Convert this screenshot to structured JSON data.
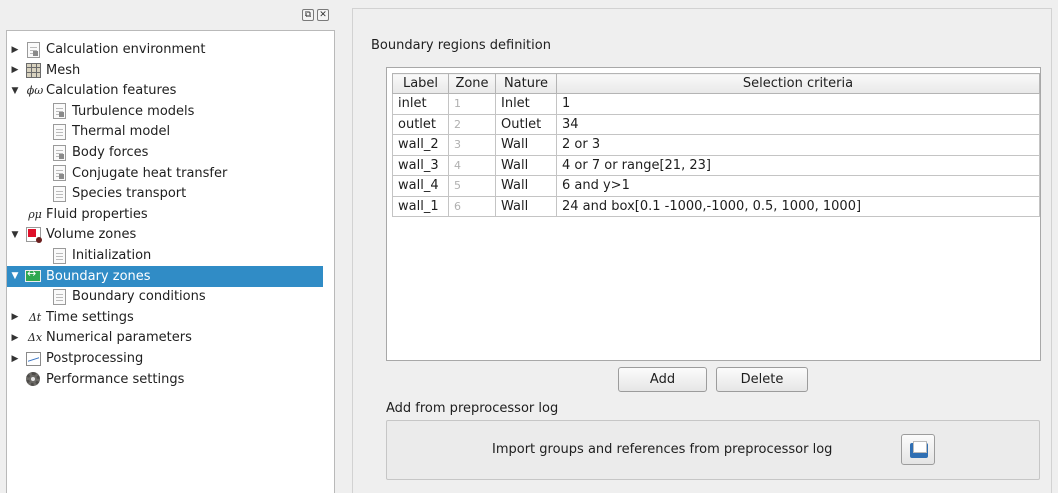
{
  "dock": {
    "float_icon": "float-window-icon",
    "close_icon": "close-icon",
    "float_glyph": "⧉",
    "close_glyph": "✕"
  },
  "tree": {
    "selected_color": "#308cc6",
    "items": [
      {
        "label": "Calculation environment",
        "arrow": "▶",
        "icon": "document-script-icon"
      },
      {
        "label": "Mesh",
        "arrow": "▶",
        "icon": "mesh-grid-icon"
      },
      {
        "label": "Calculation features",
        "arrow": "▼",
        "icon": "phi-omega-icon",
        "icon_text": "ϕω"
      },
      {
        "label": "Turbulence models",
        "arrow": "",
        "icon": "document-script-icon"
      },
      {
        "label": "Thermal model",
        "arrow": "",
        "icon": "document-icon"
      },
      {
        "label": "Body forces",
        "arrow": "",
        "icon": "document-script-icon"
      },
      {
        "label": "Conjugate heat transfer",
        "arrow": "",
        "icon": "document-script-icon"
      },
      {
        "label": "Species transport",
        "arrow": "",
        "icon": "document-icon"
      },
      {
        "label": "Fluid properties",
        "arrow": "",
        "icon": "rho-mu-icon",
        "icon_text": "ρμ"
      },
      {
        "label": "Volume zones",
        "arrow": "▼",
        "icon": "volume-zones-icon"
      },
      {
        "label": "Initialization",
        "arrow": "",
        "icon": "document-icon"
      },
      {
        "label": "Boundary zones",
        "arrow": "▼",
        "icon": "boundary-zones-icon",
        "selected": true
      },
      {
        "label": "Boundary conditions",
        "arrow": "",
        "icon": "document-icon"
      },
      {
        "label": "Time settings",
        "arrow": "▶",
        "icon": "delta-t-icon",
        "icon_text": "Δt"
      },
      {
        "label": "Numerical parameters",
        "arrow": "▶",
        "icon": "delta-x-icon",
        "icon_text": "Δx"
      },
      {
        "label": "Postprocessing",
        "arrow": "▶",
        "icon": "postprocessing-chart-icon"
      },
      {
        "label": "Performance settings",
        "arrow": "",
        "icon": "gear-icon"
      }
    ]
  },
  "main": {
    "boundary_title": "Boundary regions definition",
    "table": {
      "headers": [
        "Label",
        "Zone",
        "Nature",
        "Selection criteria"
      ],
      "rows": [
        [
          "inlet",
          "1",
          "Inlet",
          "1"
        ],
        [
          "outlet",
          "2",
          "Outlet",
          "34"
        ],
        [
          "wall_2",
          "3",
          "Wall",
          "2 or 3"
        ],
        [
          "wall_3",
          "4",
          "Wall",
          "4 or 7 or range[21, 23]"
        ],
        [
          "wall_4",
          "5",
          "Wall",
          "6 and y>1"
        ],
        [
          "wall_1",
          "6",
          "Wall",
          "24 and box[0.1 -1000,-1000, 0.5, 1000, 1000]"
        ]
      ]
    },
    "add_label": "Add",
    "delete_label": "Delete",
    "preprocessor_title": "Add from preprocessor log",
    "import_label": "Import groups and references from preprocessor log",
    "import_icon": "open-folder-icon"
  }
}
